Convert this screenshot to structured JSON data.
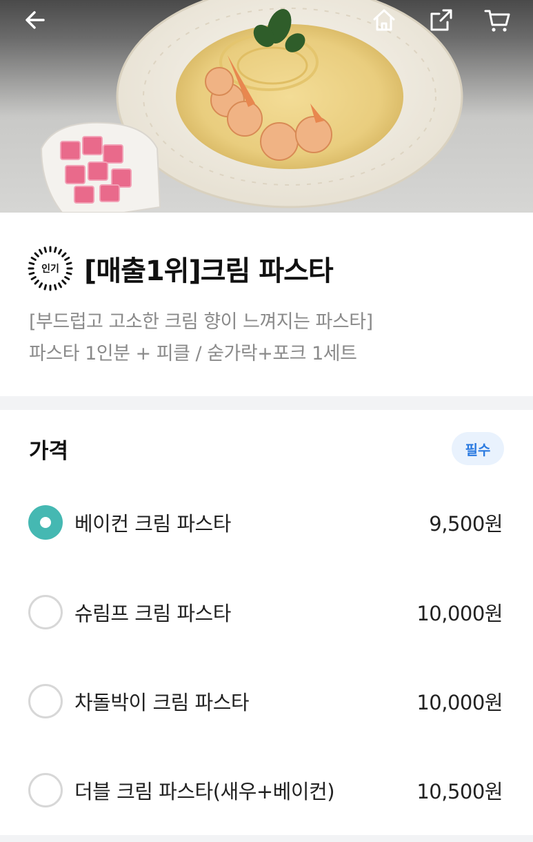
{
  "header": {
    "back_icon": "arrow-left-icon",
    "home_icon": "home-icon",
    "share_icon": "share-icon",
    "cart_icon": "cart-icon"
  },
  "hero_image": {
    "alt": "shrimp cream pasta"
  },
  "menu": {
    "badge": "인기",
    "title": "[매출1위]크림 파스타",
    "description_line1": "[부드럽고 고소한 크림 향이 느껴지는 파스타]",
    "description_line2": "파스타 1인분 + 피클 / 숟가락+포크 1세트"
  },
  "price_section": {
    "title": "가격",
    "required_label": "필수",
    "options": [
      {
        "label": "베이컨 크림 파스타",
        "price": "9,500원",
        "selected": true
      },
      {
        "label": "슈림프 크림 파스타",
        "price": "10,000원",
        "selected": false
      },
      {
        "label": "차돌박이 크림 파스타",
        "price": "10,000원",
        "selected": false
      },
      {
        "label": "더블 크림 파스타(새우+베이컨)",
        "price": "10,500원",
        "selected": false
      }
    ]
  },
  "colors": {
    "accent": "#45b8b2",
    "required_badge_bg": "#e9f2fd",
    "required_badge_text": "#2b7ae0",
    "divider": "#f2f3f5"
  }
}
